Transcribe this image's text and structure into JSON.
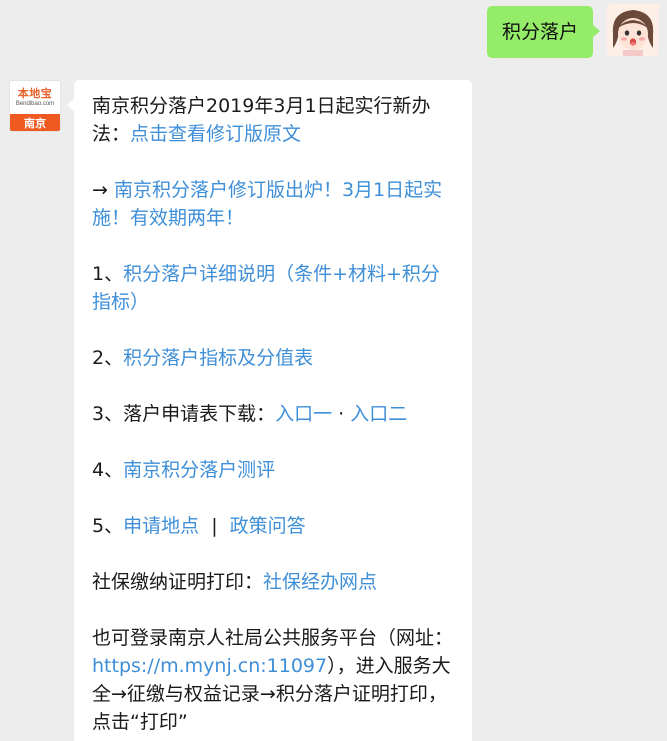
{
  "user_message": {
    "text": "积分落户"
  },
  "bot": {
    "avatar": {
      "brand": "本地宝",
      "brand_en": "Bendibao.com",
      "city": "南京"
    },
    "p1": {
      "text": "南京积分落户2019年3月1日起实行新办法：",
      "link": "点击查看修订版原文"
    },
    "p2": {
      "arrow": "→",
      "link": "南京积分落户修订版出炉！3月1日起实施！有效期两年！"
    },
    "p3": {
      "prefix": "1、",
      "link": "积分落户详细说明（条件+材料+积分指标）"
    },
    "p4": {
      "prefix": "2、",
      "link": "积分落户指标及分值表"
    },
    "p5": {
      "prefix": "3、落户申请表下载：",
      "link1": "入口一",
      "sep": " · ",
      "link2": "入口二"
    },
    "p6": {
      "prefix": "4、",
      "link": "南京积分落户测评"
    },
    "p7": {
      "prefix": "5、",
      "link1": "申请地点",
      "sep": "  |  ",
      "link2": "政策问答"
    },
    "p8": {
      "prefix": "社保缴纳证明打印：",
      "link": "社保经办网点"
    },
    "p9": {
      "text1": "也可登录南京人社局公共服务平台（网址：",
      "link": "https://m.mynj.cn:11097",
      "text2": "），进入服务大全→征缴与权益记录→积分落户证明打印，点击“打印”"
    }
  },
  "colors": {
    "background": "#ededed",
    "user_bubble": "#95ec69",
    "link": "#3f8fd8",
    "brand_orange": "#ee5a1f"
  }
}
